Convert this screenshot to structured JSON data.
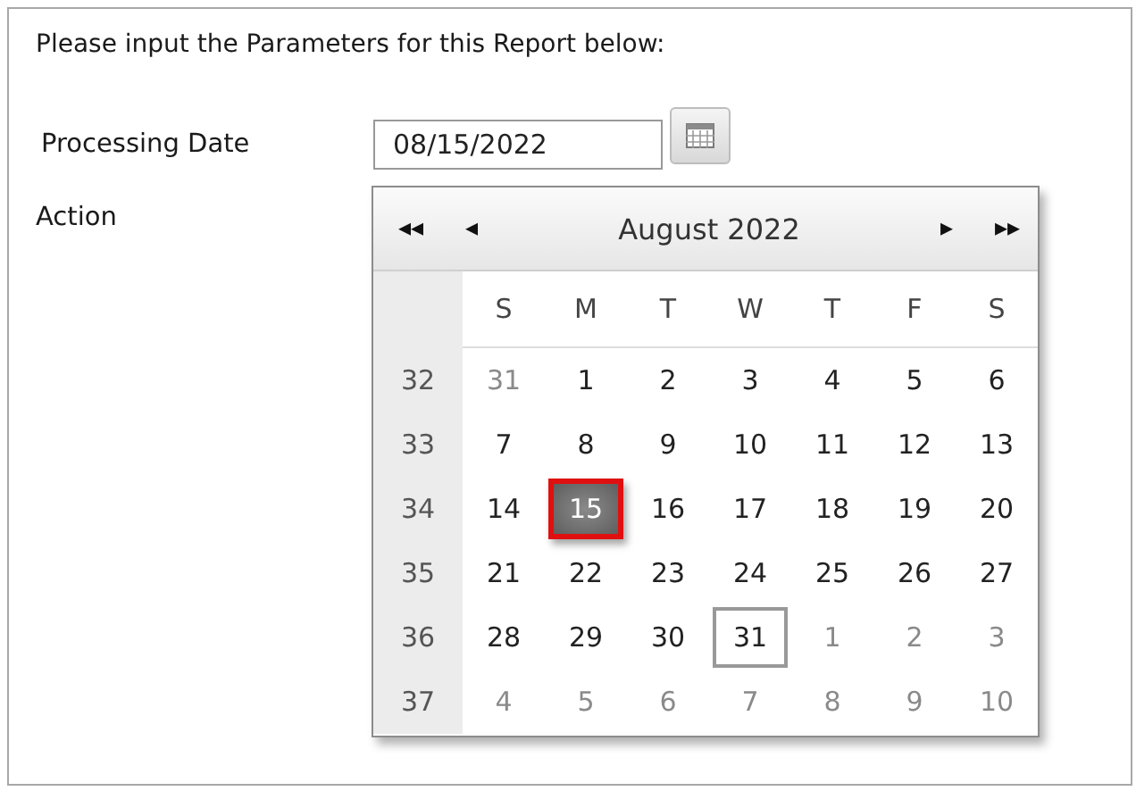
{
  "instruction": "Please input the Parameters for this Report below:",
  "parameters": [
    {
      "label": "Processing Date",
      "kind": "date",
      "value": "08/15/2022"
    },
    {
      "label": "Action",
      "kind": "plain"
    }
  ],
  "calendar": {
    "first_label": "◂◂",
    "prev_label": "◂",
    "title": "August 2022",
    "next_label": "▸",
    "last_label": "▸▸",
    "day_names": [
      "S",
      "M",
      "T",
      "W",
      "T",
      "F",
      "S"
    ],
    "weeks": [
      {
        "number": "32",
        "days": [
          {
            "label": "31",
            "other_month": true,
            "selected": false,
            "today": false
          },
          {
            "label": "1",
            "other_month": false,
            "selected": false,
            "today": false
          },
          {
            "label": "2",
            "other_month": false,
            "selected": false,
            "today": false
          },
          {
            "label": "3",
            "other_month": false,
            "selected": false,
            "today": false
          },
          {
            "label": "4",
            "other_month": false,
            "selected": false,
            "today": false
          },
          {
            "label": "5",
            "other_month": false,
            "selected": false,
            "today": false
          },
          {
            "label": "6",
            "other_month": false,
            "selected": false,
            "today": false
          }
        ]
      },
      {
        "number": "33",
        "days": [
          {
            "label": "7",
            "other_month": false,
            "selected": false,
            "today": false
          },
          {
            "label": "8",
            "other_month": false,
            "selected": false,
            "today": false
          },
          {
            "label": "9",
            "other_month": false,
            "selected": false,
            "today": false
          },
          {
            "label": "10",
            "other_month": false,
            "selected": false,
            "today": false
          },
          {
            "label": "11",
            "other_month": false,
            "selected": false,
            "today": false
          },
          {
            "label": "12",
            "other_month": false,
            "selected": false,
            "today": false
          },
          {
            "label": "13",
            "other_month": false,
            "selected": false,
            "today": false
          }
        ]
      },
      {
        "number": "34",
        "days": [
          {
            "label": "14",
            "other_month": false,
            "selected": false,
            "today": false
          },
          {
            "label": "15",
            "other_month": false,
            "selected": true,
            "today": false
          },
          {
            "label": "16",
            "other_month": false,
            "selected": false,
            "today": false
          },
          {
            "label": "17",
            "other_month": false,
            "selected": false,
            "today": false
          },
          {
            "label": "18",
            "other_month": false,
            "selected": false,
            "today": false
          },
          {
            "label": "19",
            "other_month": false,
            "selected": false,
            "today": false
          },
          {
            "label": "20",
            "other_month": false,
            "selected": false,
            "today": false
          }
        ]
      },
      {
        "number": "35",
        "days": [
          {
            "label": "21",
            "other_month": false,
            "selected": false,
            "today": false
          },
          {
            "label": "22",
            "other_month": false,
            "selected": false,
            "today": false
          },
          {
            "label": "23",
            "other_month": false,
            "selected": false,
            "today": false
          },
          {
            "label": "24",
            "other_month": false,
            "selected": false,
            "today": false
          },
          {
            "label": "25",
            "other_month": false,
            "selected": false,
            "today": false
          },
          {
            "label": "26",
            "other_month": false,
            "selected": false,
            "today": false
          },
          {
            "label": "27",
            "other_month": false,
            "selected": false,
            "today": false
          }
        ]
      },
      {
        "number": "36",
        "days": [
          {
            "label": "28",
            "other_month": false,
            "selected": false,
            "today": false
          },
          {
            "label": "29",
            "other_month": false,
            "selected": false,
            "today": false
          },
          {
            "label": "30",
            "other_month": false,
            "selected": false,
            "today": false
          },
          {
            "label": "31",
            "other_month": false,
            "selected": false,
            "today": true
          },
          {
            "label": "1",
            "other_month": true,
            "selected": false,
            "today": false
          },
          {
            "label": "2",
            "other_month": true,
            "selected": false,
            "today": false
          },
          {
            "label": "3",
            "other_month": true,
            "selected": false,
            "today": false
          }
        ]
      },
      {
        "number": "37",
        "days": [
          {
            "label": "4",
            "other_month": true,
            "selected": false,
            "today": false
          },
          {
            "label": "5",
            "other_month": true,
            "selected": false,
            "today": false
          },
          {
            "label": "6",
            "other_month": true,
            "selected": false,
            "today": false
          },
          {
            "label": "7",
            "other_month": true,
            "selected": false,
            "today": false
          },
          {
            "label": "8",
            "other_month": true,
            "selected": false,
            "today": false
          },
          {
            "label": "9",
            "other_month": true,
            "selected": false,
            "today": false
          },
          {
            "label": "10",
            "other_month": true,
            "selected": false,
            "today": false
          }
        ]
      }
    ]
  }
}
